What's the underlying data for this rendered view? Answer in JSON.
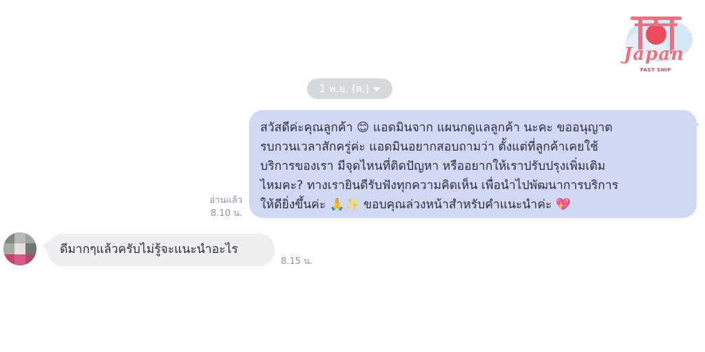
{
  "logo": {
    "text": "Japan",
    "subtext": "FAST SHIP",
    "colors": {
      "sun": "#e94c5c",
      "gate": "#e8737f",
      "cloud": "#cfe3f5"
    }
  },
  "date_separator": {
    "label": "1 พ.ย. (ส.)",
    "icon": "chevron-down-icon"
  },
  "outgoing_message": {
    "lines": [
      "สวัสดีค่ะคุณลูกค้า 😊 แอดมินจาก แผนกดูแลลูกค้า นะคะ ขออนุญาต",
      "รบกวนเวลาสักครู่ค่ะ แอดมินอยากสอบถามว่า ตั้งแต่ที่ลูกค้าเคยใช้",
      "บริการของเรา มีจุดไหนที่ติดปัญหา หรืออยากให้เราปรับปรุงเพิ่มเติม",
      "ไหมคะ? ทางเรายินดีรับฟังทุกความคิดเห็น เพื่อนำไปพัฒนาการบริการ",
      "ให้ดียิ่งขึ้นค่ะ 🙏✨ ขอบคุณล่วงหน้าสำหรับคำแนะนำค่ะ 💖"
    ],
    "read_status": "อ่านแล้ว",
    "time": "8.10 น.",
    "bubble_color": "#cfd9f3"
  },
  "incoming_message": {
    "text": "ดีมากๆแล้วครับไม่รู้จะแนะนำอะไร",
    "time": "8.15 น.",
    "bubble_color": "#eceeef",
    "avatar": "blurred-user-avatar"
  }
}
